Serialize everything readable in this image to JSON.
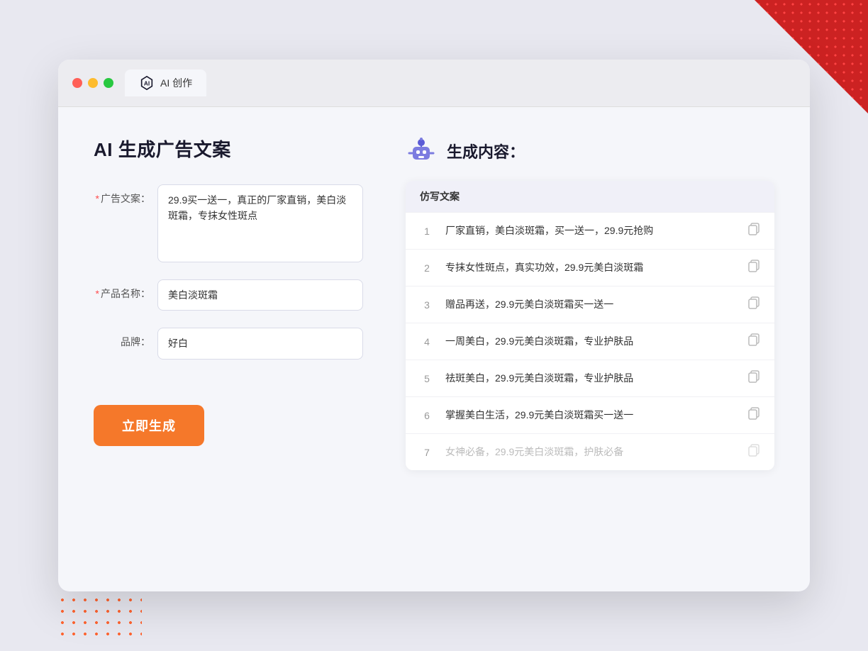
{
  "window": {
    "tab_label": "AI 创作"
  },
  "left_panel": {
    "title": "AI 生成广告文案",
    "form": {
      "ad_copy_label": "广告文案：",
      "ad_copy_required": "*",
      "ad_copy_value": "29.9买一送一，真正的厂家直销，美白淡斑霜，专抹女性斑点",
      "product_name_label": "产品名称：",
      "product_name_required": "*",
      "product_name_value": "美白淡斑霜",
      "brand_label": "品牌：",
      "brand_value": "好白"
    },
    "generate_button": "立即生成"
  },
  "right_panel": {
    "title": "生成内容：",
    "table_header": "仿写文案",
    "results": [
      {
        "num": "1",
        "text": "厂家直销，美白淡斑霜，买一送一，29.9元抢购",
        "faded": false
      },
      {
        "num": "2",
        "text": "专抹女性斑点，真实功效，29.9元美白淡斑霜",
        "faded": false
      },
      {
        "num": "3",
        "text": "赠品再送，29.9元美白淡斑霜买一送一",
        "faded": false
      },
      {
        "num": "4",
        "text": "一周美白，29.9元美白淡斑霜，专业护肤品",
        "faded": false
      },
      {
        "num": "5",
        "text": "祛斑美白，29.9元美白淡斑霜，专业护肤品",
        "faded": false
      },
      {
        "num": "6",
        "text": "掌握美白生活，29.9元美白淡斑霜买一送一",
        "faded": false
      },
      {
        "num": "7",
        "text": "女神必备，29.9元美白淡斑霜，护肤必备",
        "faded": true
      }
    ]
  },
  "colors": {
    "accent": "#f5782a",
    "required": "#ff4d4f",
    "tab_icon_bg": "#1a1a2e"
  }
}
